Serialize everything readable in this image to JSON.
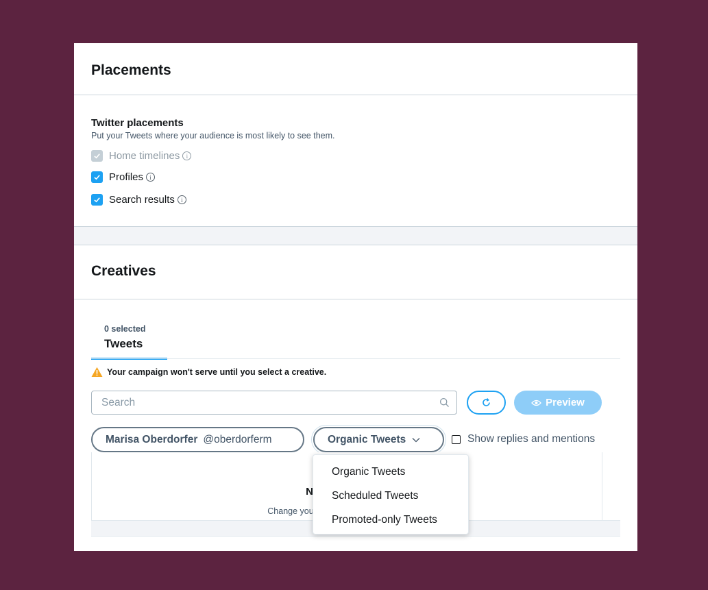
{
  "placements": {
    "title": "Placements",
    "subtitle": "Twitter placements",
    "description": "Put your Tweets where your audience is most likely to see them.",
    "options": [
      {
        "label": "Home timelines",
        "checked": true,
        "disabled": true
      },
      {
        "label": "Profiles",
        "checked": true,
        "disabled": false
      },
      {
        "label": "Search results",
        "checked": true,
        "disabled": false
      }
    ],
    "info_glyph": "i"
  },
  "creatives": {
    "title": "Creatives",
    "tab": {
      "count": "0 selected",
      "label": "Tweets"
    },
    "warning": "Your campaign won't serve until you select a creative.",
    "search_placeholder": "Search",
    "preview_label": "Preview",
    "user": {
      "name": "Marisa Oberdorfer",
      "handle": "@oberdorferm"
    },
    "filter": {
      "selected": "Organic Tweets",
      "options": [
        "Organic Tweets",
        "Scheduled Tweets",
        "Promoted-only Tweets"
      ]
    },
    "show_replies_label": "Show replies and mentions",
    "show_replies_checked": false,
    "empty_title": "Nothing matches",
    "empty_description": "Change your filter selections and try again"
  },
  "colors": {
    "background": "#5c2340",
    "accent": "#1da1f2",
    "preview_disabled": "#8ecdf8",
    "warning": "#f5a623"
  }
}
